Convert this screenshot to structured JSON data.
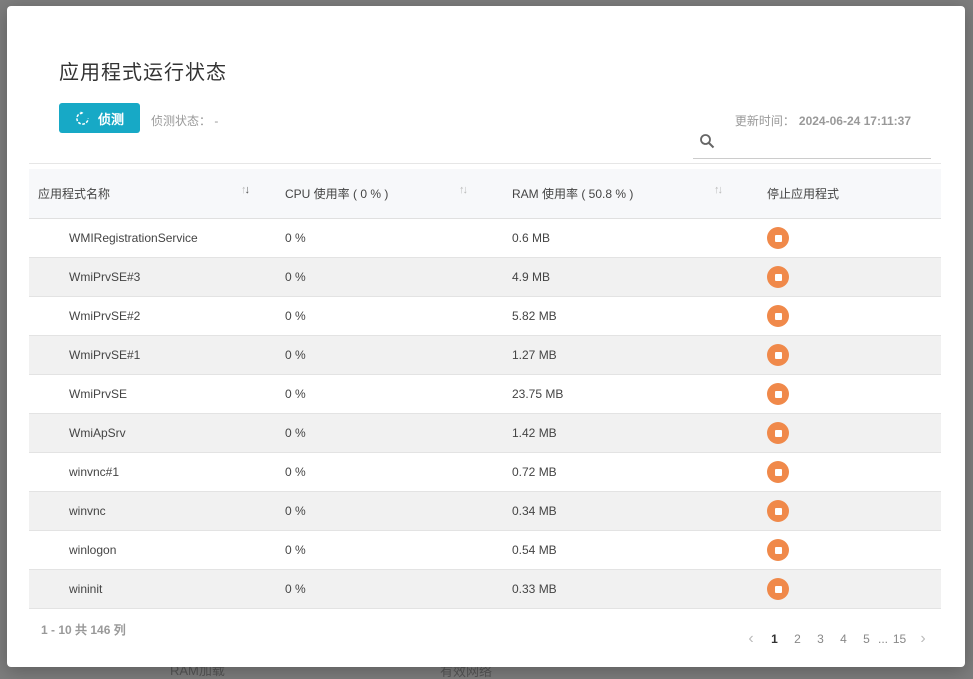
{
  "backdrop": {
    "ghost_left": "RAM加载",
    "ghost_right": "有效网络"
  },
  "dialog": {
    "title": "应用程式运行状态",
    "detect_button": "侦测",
    "detect_status": "侦测状态： -",
    "update_time_label": "更新时间：",
    "update_time_value": "2024-06-24 17:11:37",
    "search_placeholder": ""
  },
  "table": {
    "headers": {
      "name": "应用程式名称",
      "cpu": "CPU 使用率 ( 0 % )",
      "ram": "RAM 使用率 ( 50.8 % )",
      "stop": "停止应用程式"
    },
    "rows": [
      {
        "name": "WMIRegistrationService",
        "cpu": "0 %",
        "ram": "0.6 MB"
      },
      {
        "name": "WmiPrvSE#3",
        "cpu": "0 %",
        "ram": "4.9 MB"
      },
      {
        "name": "WmiPrvSE#2",
        "cpu": "0 %",
        "ram": "5.82 MB"
      },
      {
        "name": "WmiPrvSE#1",
        "cpu": "0 %",
        "ram": "1.27 MB"
      },
      {
        "name": "WmiPrvSE",
        "cpu": "0 %",
        "ram": "23.75 MB"
      },
      {
        "name": "WmiApSrv",
        "cpu": "0 %",
        "ram": "1.42 MB"
      },
      {
        "name": "winvnc#1",
        "cpu": "0 %",
        "ram": "0.72 MB"
      },
      {
        "name": "winvnc",
        "cpu": "0 %",
        "ram": "0.34 MB"
      },
      {
        "name": "winlogon",
        "cpu": "0 %",
        "ram": "0.54 MB"
      },
      {
        "name": "wininit",
        "cpu": "0 %",
        "ram": "0.33 MB"
      }
    ]
  },
  "footer": {
    "total": "1 - 10 共 146 列",
    "pages": [
      "1",
      "2",
      "3",
      "4",
      "5"
    ],
    "ellipsis": "...",
    "last_page": "15",
    "current_page": "1"
  },
  "colors": {
    "accent": "#17a9c6",
    "stop": "#f0894a"
  },
  "icons": {
    "detect": "refresh-icon",
    "search": "search-icon",
    "sort": "sort-arrows-icon",
    "stop": "stop-icon",
    "prev": "chevron-left-icon",
    "next": "chevron-right-icon"
  }
}
